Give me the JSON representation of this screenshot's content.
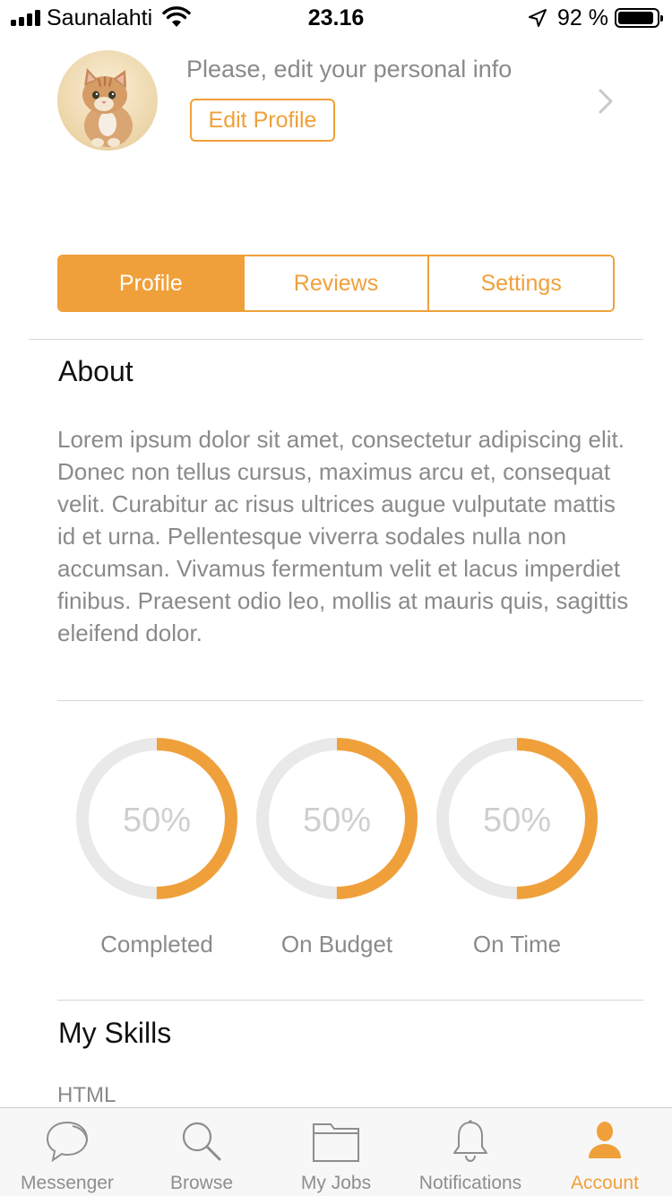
{
  "status_bar": {
    "carrier": "Saunalahti",
    "time": "23.16",
    "battery_percent": "92 %",
    "battery_level": 0.92
  },
  "profile_header": {
    "prompt": "Please, edit your personal info",
    "edit_button_label": "Edit Profile"
  },
  "segments": {
    "items": [
      {
        "label": "Profile",
        "active": true
      },
      {
        "label": "Reviews",
        "active": false
      },
      {
        "label": "Settings",
        "active": false
      }
    ]
  },
  "about": {
    "title": "About",
    "body": "Lorem ipsum dolor sit amet, consectetur adipiscing elit. Donec non tellus cursus, maximus arcu et, consequat velit. Curabitur ac risus ultrices augue vulputate mattis id et urna. Pellentesque viverra sodales nulla non accumsan. Vivamus fermentum velit et lacus imperdiet finibus. Praesent odio leo, mollis at mauris quis, sagittis eleifend dolor."
  },
  "stats": [
    {
      "label": "Completed",
      "percent_text": "50%",
      "value": 0.5
    },
    {
      "label": "On Budget",
      "percent_text": "50%",
      "value": 0.5
    },
    {
      "label": "On Time",
      "percent_text": "50%",
      "value": 0.5
    }
  ],
  "skills": {
    "title": "My Skills",
    "items": [
      "HTML"
    ]
  },
  "tab_bar": {
    "items": [
      {
        "label": "Messenger",
        "icon": "chat-bubble-icon",
        "active": false
      },
      {
        "label": "Browse",
        "icon": "search-icon",
        "active": false
      },
      {
        "label": "My Jobs",
        "icon": "folder-icon",
        "active": false
      },
      {
        "label": "Notifications",
        "icon": "bell-icon",
        "active": false
      },
      {
        "label": "Account",
        "icon": "person-icon",
        "active": true
      }
    ]
  },
  "colors": {
    "accent": "#f0a03a",
    "ring_track": "#e9e9e9",
    "muted_text": "#8a8a8a",
    "tab_inactive": "#8e8e8e"
  }
}
